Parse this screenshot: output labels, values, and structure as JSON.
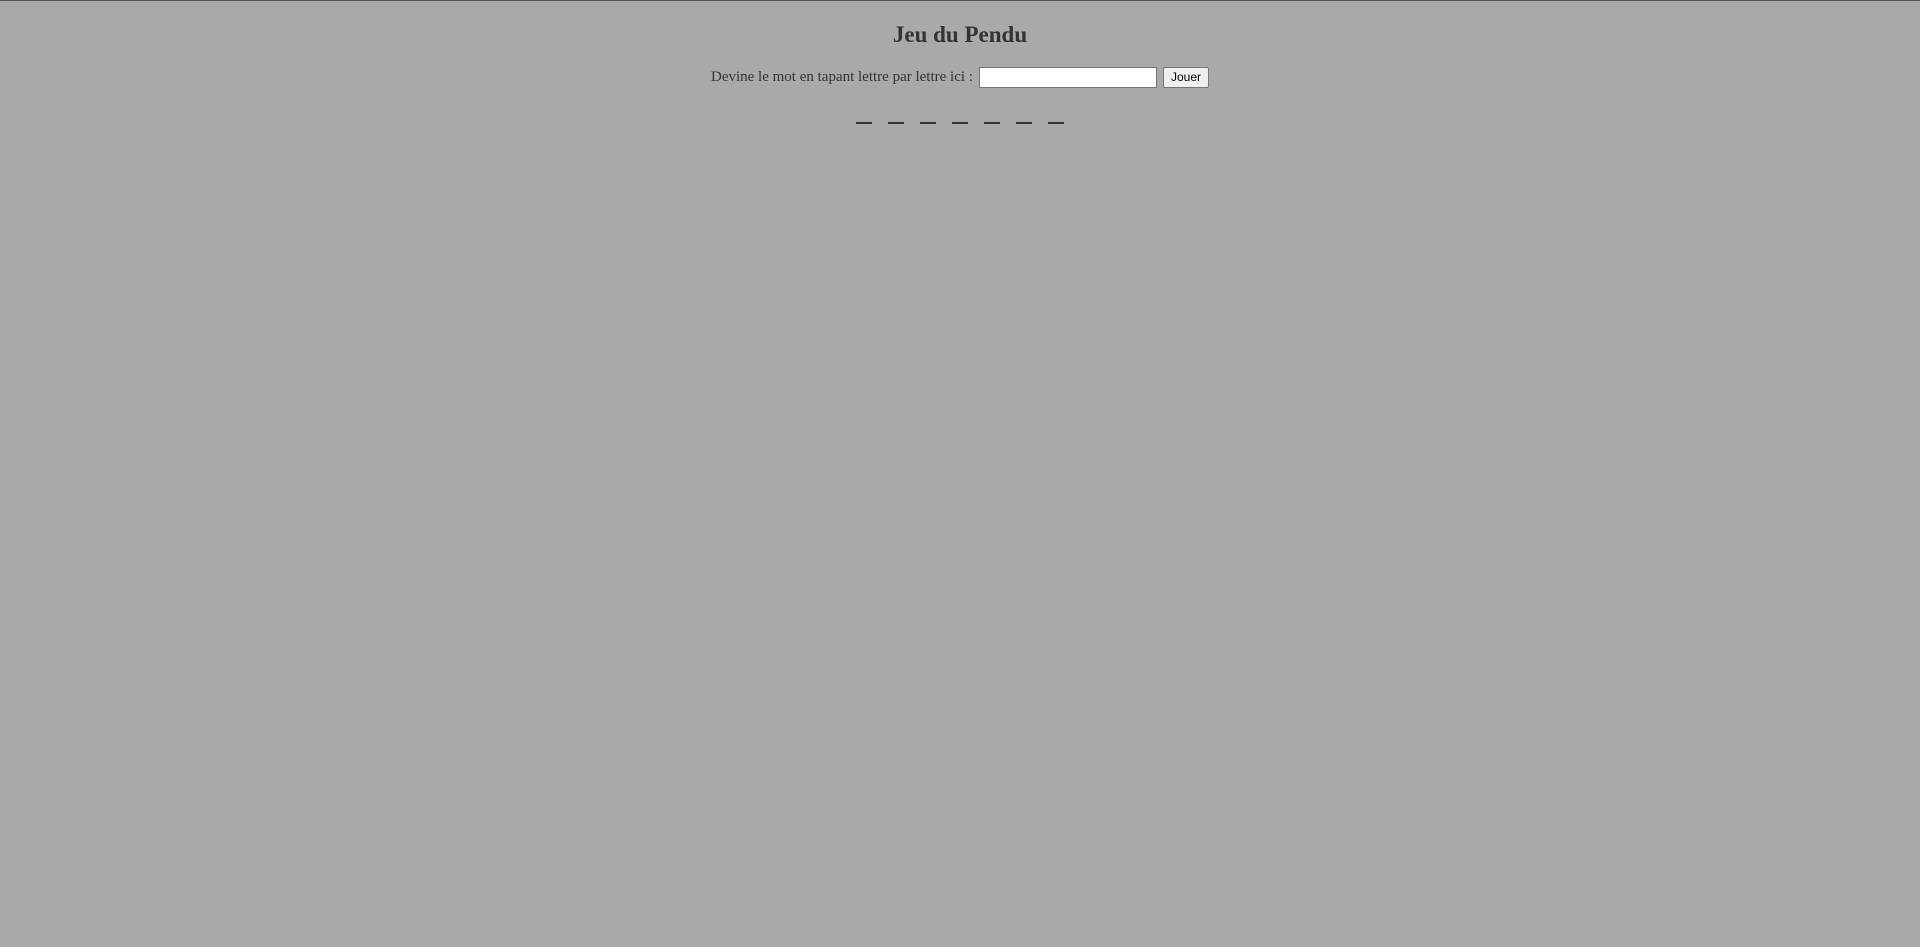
{
  "page": {
    "title": "Jeu du Pendu"
  },
  "form": {
    "prompt_label": "Devine le mot en tapant lettre par lettre ici :",
    "input_value": "",
    "play_button_label": "Jouer"
  },
  "word": {
    "letters": [
      "",
      "",
      "",
      "",
      "",
      "",
      ""
    ]
  }
}
